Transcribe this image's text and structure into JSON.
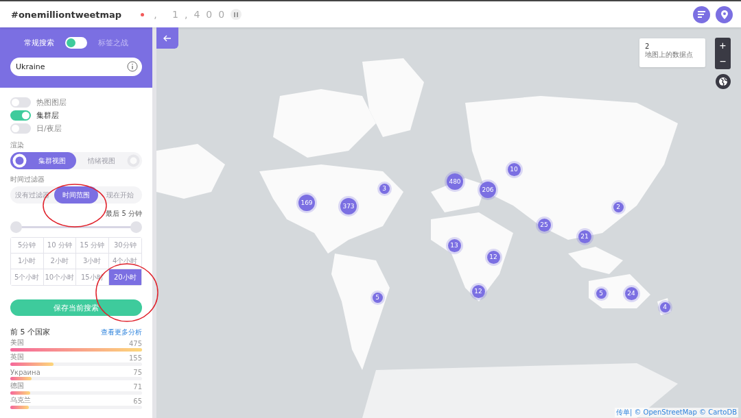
{
  "header": {
    "title": "#onemilliontweetmap",
    "live_indicator": {
      "on": true
    },
    "counter": ", 1,400",
    "paused": false
  },
  "sidebar": {
    "mode_options": [
      {
        "label": "常规搜索",
        "selected": true
      },
      {
        "label": "标签之战",
        "selected": false
      }
    ],
    "search": {
      "value": "Ukraine"
    },
    "layers": [
      {
        "label": "热图图层",
        "on": false
      },
      {
        "label": "集群层",
        "on": true
      },
      {
        "label": "日/夜层",
        "on": false
      }
    ],
    "render": {
      "label": "渲染",
      "options": [
        {
          "label": "集群视图",
          "selected": true
        },
        {
          "label": "情绪视图",
          "selected": false
        }
      ]
    },
    "time_filter": {
      "label": "时间过滤器",
      "options": [
        {
          "label": "没有过滤器",
          "selected": false
        },
        {
          "label": "时间范围",
          "selected": true
        },
        {
          "label": "现在开始",
          "selected": false
        }
      ],
      "range_label": "最后 5 分钟",
      "slider": {
        "level": 1
      },
      "presets": [
        {
          "label": "5分钟",
          "selected": false
        },
        {
          "label": "10 分钟",
          "selected": false
        },
        {
          "label": "15 分钟",
          "selected": false
        },
        {
          "label": "30分钟",
          "selected": false
        },
        {
          "label": "1小时",
          "selected": false
        },
        {
          "label": "2小时",
          "selected": false
        },
        {
          "label": "3小时",
          "selected": false
        },
        {
          "label": "4个小时",
          "selected": false
        },
        {
          "label": "5个小时",
          "selected": false
        },
        {
          "label": "10个小时",
          "selected": false
        },
        {
          "label": "15小时",
          "selected": false
        },
        {
          "label": "20小时",
          "selected": true
        }
      ]
    },
    "save_button": "保存当前搜索",
    "top_countries": {
      "title": "前 5 个国家",
      "link": "查看更多分析",
      "rows": [
        {
          "name": "美国",
          "count": "475",
          "level": 1
        },
        {
          "name": "英国",
          "count": "155",
          "level": 0.33
        },
        {
          "name": "Украина",
          "count": "75",
          "level": 0.16
        },
        {
          "name": "德国",
          "count": "71",
          "level": 0.15
        },
        {
          "name": "乌克兰",
          "count": "65",
          "level": 0.14
        }
      ]
    }
  },
  "map": {
    "info": {
      "count": "2",
      "label": "地图上的数据点"
    },
    "zoom_in": "+",
    "zoom_out": "−",
    "clusters": [
      "480",
      "10",
      "206",
      "3",
      "169",
      "373",
      "2",
      "25",
      "21",
      "13",
      "12",
      "12",
      "5",
      "5",
      "24",
      "4"
    ],
    "attribution": "传单| © OpenStreetMap © CartoDB"
  }
}
